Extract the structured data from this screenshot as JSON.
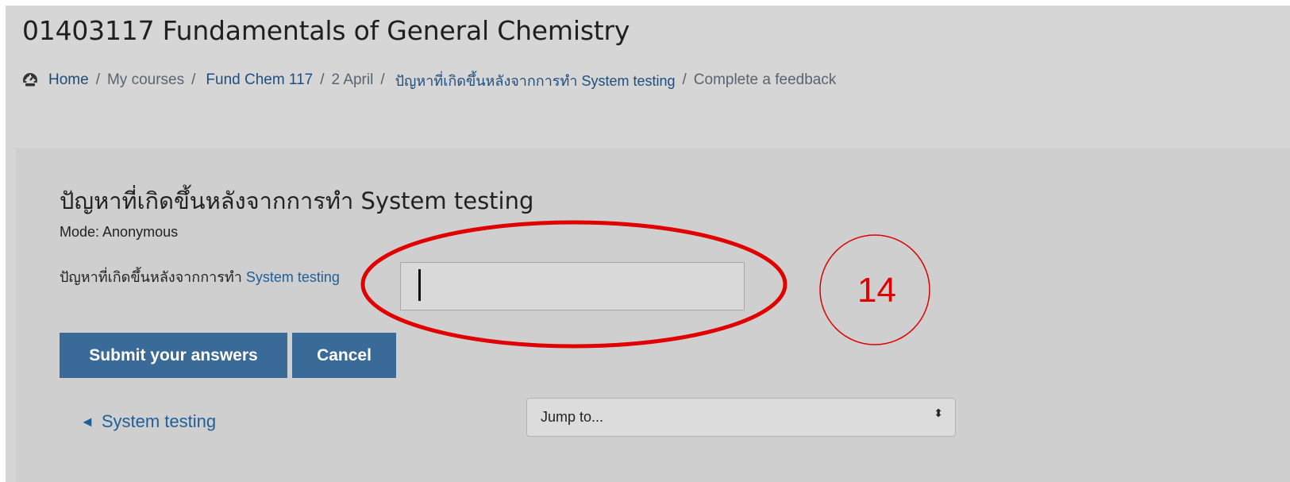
{
  "course": {
    "title": "01403117 Fundamentals of General Chemistry"
  },
  "breadcrumb": {
    "icon": "dashboard-icon",
    "items": [
      "Home",
      "My courses",
      "Fund Chem 117",
      "2 April",
      "ปัญหาที่เกิดขึ้นหลังจากการทำ System testing",
      "Complete a feedback"
    ],
    "separator": "/"
  },
  "activity": {
    "title": "ปัญหาที่เกิดขึ้นหลังจากการทำ System testing",
    "mode": "Mode: Anonymous"
  },
  "question": {
    "label_thai": "ปัญหาที่เกิดขึ้นหลังจากการทำ",
    "label_link": "System testing",
    "answer_value": ""
  },
  "buttons": {
    "submit": "Submit your answers",
    "cancel": "Cancel"
  },
  "navigation": {
    "prev_arrow": "◄",
    "prev_label": "System testing",
    "jump_placeholder": "Jump to...",
    "jump_arrows": "⬍"
  },
  "annotation": {
    "step_number": "14",
    "color": "#e00000"
  },
  "colors": {
    "primary_button": "#3a6a97",
    "link": "#1f5f99",
    "page_background": "#d6d6d6"
  }
}
